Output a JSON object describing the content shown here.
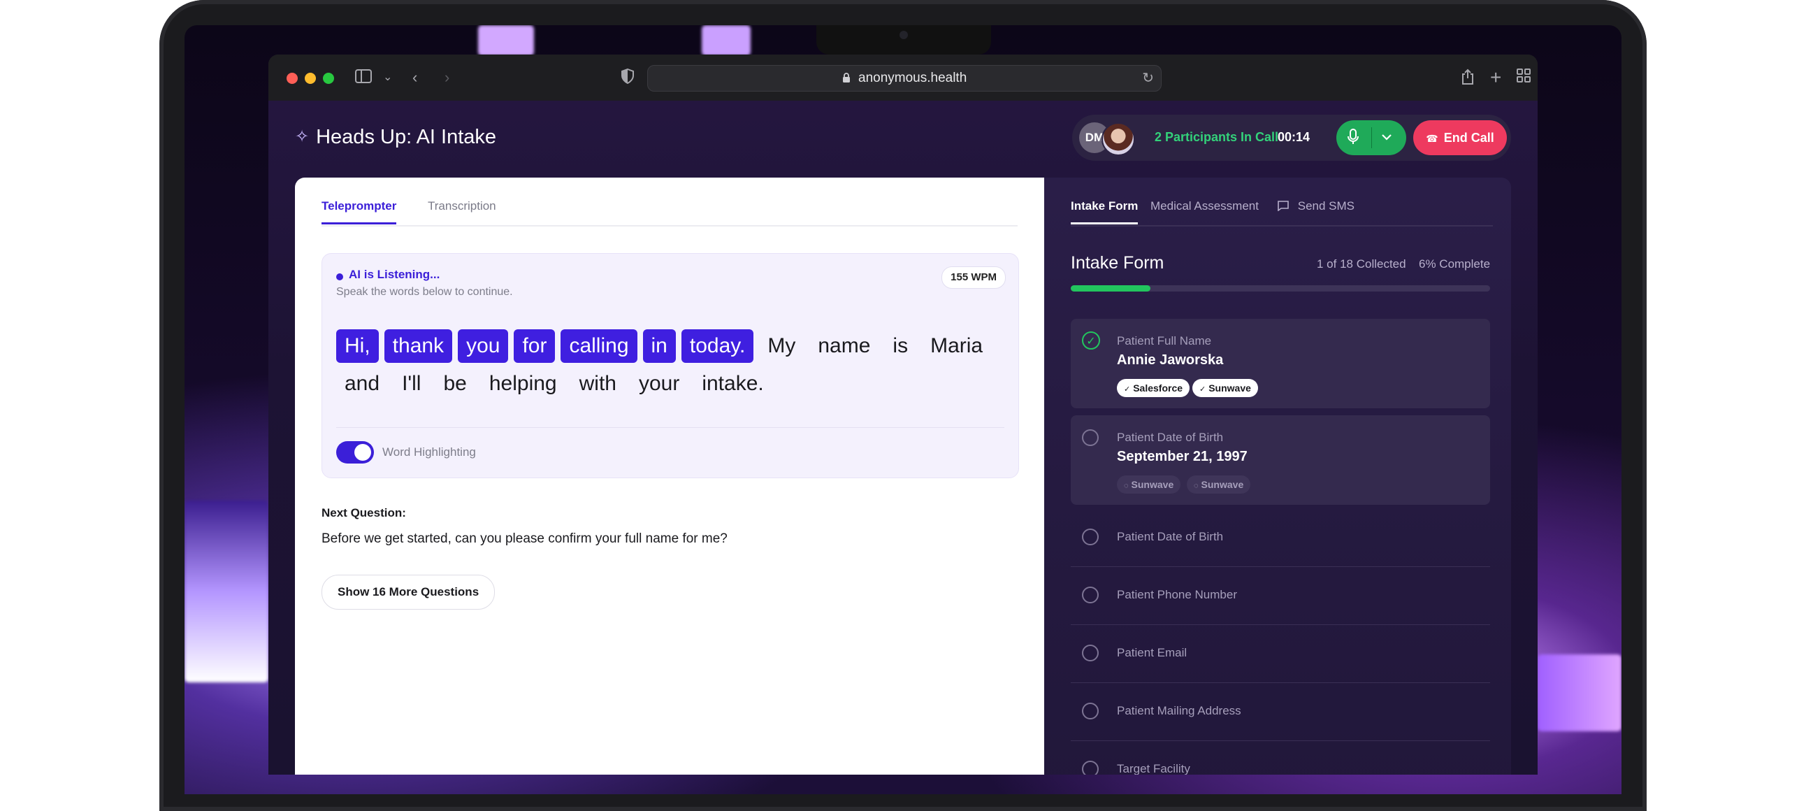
{
  "browser": {
    "url": "anonymous.health"
  },
  "app": {
    "title": "Heads Up: AI Intake"
  },
  "call": {
    "avatar_initials": "DM",
    "participants": "2 Participants In Call",
    "timer": "00:14",
    "end_call_label": "End Call"
  },
  "left_tabs": [
    {
      "label": "Teleprompter",
      "active": true
    },
    {
      "label": "Transcription",
      "active": false
    }
  ],
  "teleprompter": {
    "status": "AI is Listening...",
    "hint": "Speak the words below to continue.",
    "wpm": "155 WPM",
    "words": [
      {
        "text": "Hi,",
        "spoken": true
      },
      {
        "text": "thank",
        "spoken": true
      },
      {
        "text": "you",
        "spoken": true
      },
      {
        "text": "for",
        "spoken": true
      },
      {
        "text": "calling",
        "spoken": true
      },
      {
        "text": "in",
        "spoken": true
      },
      {
        "text": "today.",
        "spoken": true
      },
      {
        "text": "My",
        "spoken": false
      },
      {
        "text": "name",
        "spoken": false
      },
      {
        "text": "is",
        "spoken": false
      },
      {
        "text": "Maria",
        "spoken": false
      },
      {
        "text": "and",
        "spoken": false
      },
      {
        "text": "I'll",
        "spoken": false
      },
      {
        "text": "be",
        "spoken": false
      },
      {
        "text": "helping",
        "spoken": false
      },
      {
        "text": "with",
        "spoken": false
      },
      {
        "text": "your",
        "spoken": false
      },
      {
        "text": "intake.",
        "spoken": false
      }
    ],
    "toggle_label": "Word Highlighting",
    "toggle_on": true
  },
  "next_question": {
    "label": "Next Question:",
    "text": "Before we get started, can you please confirm your full name for me?",
    "more_button": "Show 16 More Questions"
  },
  "right_tabs": [
    {
      "label": "Intake Form",
      "active": true
    },
    {
      "label": "Medical Assessment",
      "active": false
    },
    {
      "label": "Send SMS",
      "active": false
    }
  ],
  "intake": {
    "title": "Intake Form",
    "collected": "1 of 18 Collected",
    "complete": "6% Complete",
    "progress_percent": 19,
    "fields": [
      {
        "label": "Patient Full Name",
        "value": "Annie Jaworska",
        "done": true,
        "chips": [
          {
            "text": "Salesforce",
            "style": "solid"
          },
          {
            "text": "Sunwave",
            "style": "solid"
          }
        ]
      },
      {
        "label": "Patient Date of Birth",
        "value": "September 21, 1997",
        "done": false,
        "chips": [
          {
            "text": "Sunwave",
            "style": "ghost"
          },
          {
            "text": "Sunwave",
            "style": "ghost"
          }
        ]
      },
      {
        "label": "Patient Date of Birth",
        "value": "",
        "done": false,
        "chips": []
      },
      {
        "label": "Patient Phone Number",
        "value": "",
        "done": false,
        "chips": []
      },
      {
        "label": "Patient Email",
        "value": "",
        "done": false,
        "chips": []
      },
      {
        "label": "Patient Mailing Address",
        "value": "",
        "done": false,
        "chips": []
      },
      {
        "label": "Target Facility",
        "value": "",
        "done": false,
        "chips": []
      }
    ]
  },
  "colors": {
    "accent": "#3f1fe0",
    "success": "#22c55e",
    "danger": "#ee3a5f"
  }
}
